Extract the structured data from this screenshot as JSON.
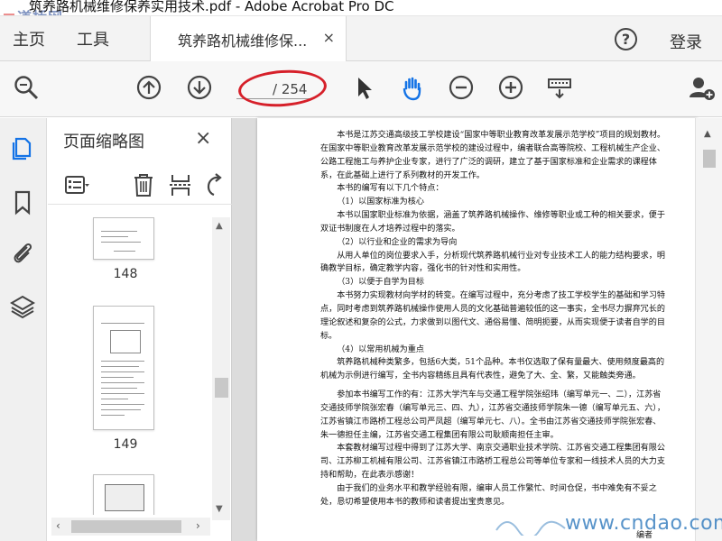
{
  "window": {
    "title": "筑养路机械维修保养实用技术.pdf - Adobe Acrobat Pro DC",
    "watermark_top_left": "道桥网"
  },
  "menubar": {
    "home": "主页",
    "tools": "工具",
    "doc_tab_label": "筑养路机械维修保...",
    "doc_tab_close": "×",
    "help": "?",
    "login": "登录"
  },
  "toolbar": {
    "search_icon": "zoom-search-icon",
    "prev_page_icon": "arrow-up-circle-icon",
    "next_page_icon": "arrow-down-circle-icon",
    "current_page": "",
    "total_pages": "/ 254",
    "select_icon": "pointer-arrow-icon",
    "hand_icon": "hand-tool-icon",
    "zoom_out_icon": "minus-circle-icon",
    "zoom_in_icon": "plus-circle-icon",
    "keyboard_icon": "scroll-mode-icon",
    "share_icon": "add-user-icon",
    "accent_color": "#1473e6",
    "highlight_color": "#d6202a"
  },
  "thumbnail_panel": {
    "title": "页面缩略图",
    "close": "×",
    "thumbnails": [
      {
        "label": "148"
      },
      {
        "label": "149"
      },
      {
        "label": ""
      }
    ]
  },
  "document": {
    "paragraphs": [
      "本书是江苏交通高级技工学校建设“国家中等职业教育改革发展示范学校”项目的规划教材。在国家中等职业教育改革发展示范学校的建设过程中，编者联合高等院校、工程机械生产企业、公路工程施工与养护企业专家，进行了广泛的调研，建立了基于国家标准和企业需求的课程体系，在此基础上进行了系列教材的开发工作。",
      "本书的编写有以下几个特点：",
      "（1）以国家标准为核心",
      "本书以国家职业标准为依据，涵盖了筑养路机械操作、维修等职业或工种的相关要求，便于双证书制度在人才培养过程中的落实。",
      "（2）以行业和企业的需求为导向",
      "从用人单位的岗位要求入手，分析现代筑养路机械行业对专业技术工人的能力结构要求，明确教学目标，确定教学内容，强化书的针对性和实用性。",
      "（3）以便于自学为目标",
      "本书努力实现教材向学材的转变。在编写过程中，充分考虑了技工学校学生的基础和学习特点，同时考虑到筑养路机械操作使用人员的文化基础普遍较低的这一事实，全书尽力摒弃冗长的理论叙述和复杂的公式，力求做到以图代文、通俗易懂、简明扼要，从而实现便于读者自学的目标。",
      "（4）以常用机械为重点",
      "筑养路机械种类繁多，包括6大类，51个品种。本书仅选取了保有量最大、使用频度最高的机械为示例进行编写，全书内容精练且具有代表性，避免了大、全、繁，又能触类旁通。",
      "参加本书编写工作的有：江苏大学汽车与交通工程学院张绍玮（编写单元一、二），江苏省交通技师学院张宏春（编写单元三、四、九），江苏省交通技师学院朱一德（编写单元五、六），江苏省镇江市路桥工程总公司严凤超（编写单元七、八）。全书由江苏省交通技师学院张宏春、朱一德担任主编，江苏省交通工程集团有限公司耿顺南担任主审。",
      "本套教材编写过程中得到了江苏大学、南京交通职业技术学院、江苏省交通工程集团有限公司、江苏柳工机械有限公司、江苏省镇江市路桥工程总公司等单位专家和一线技术人员的大力支持和帮助，在此表示感谢！",
      "由于我们的业务水平和教学经验有限，编审人员工作繁忙、时间仓促，书中难免有不妥之处，恳切希望使用本书的教师和读者提出宝贵意见。"
    ],
    "author_sign": "编者",
    "watermark_bottom_right": "www.cndao.com"
  }
}
